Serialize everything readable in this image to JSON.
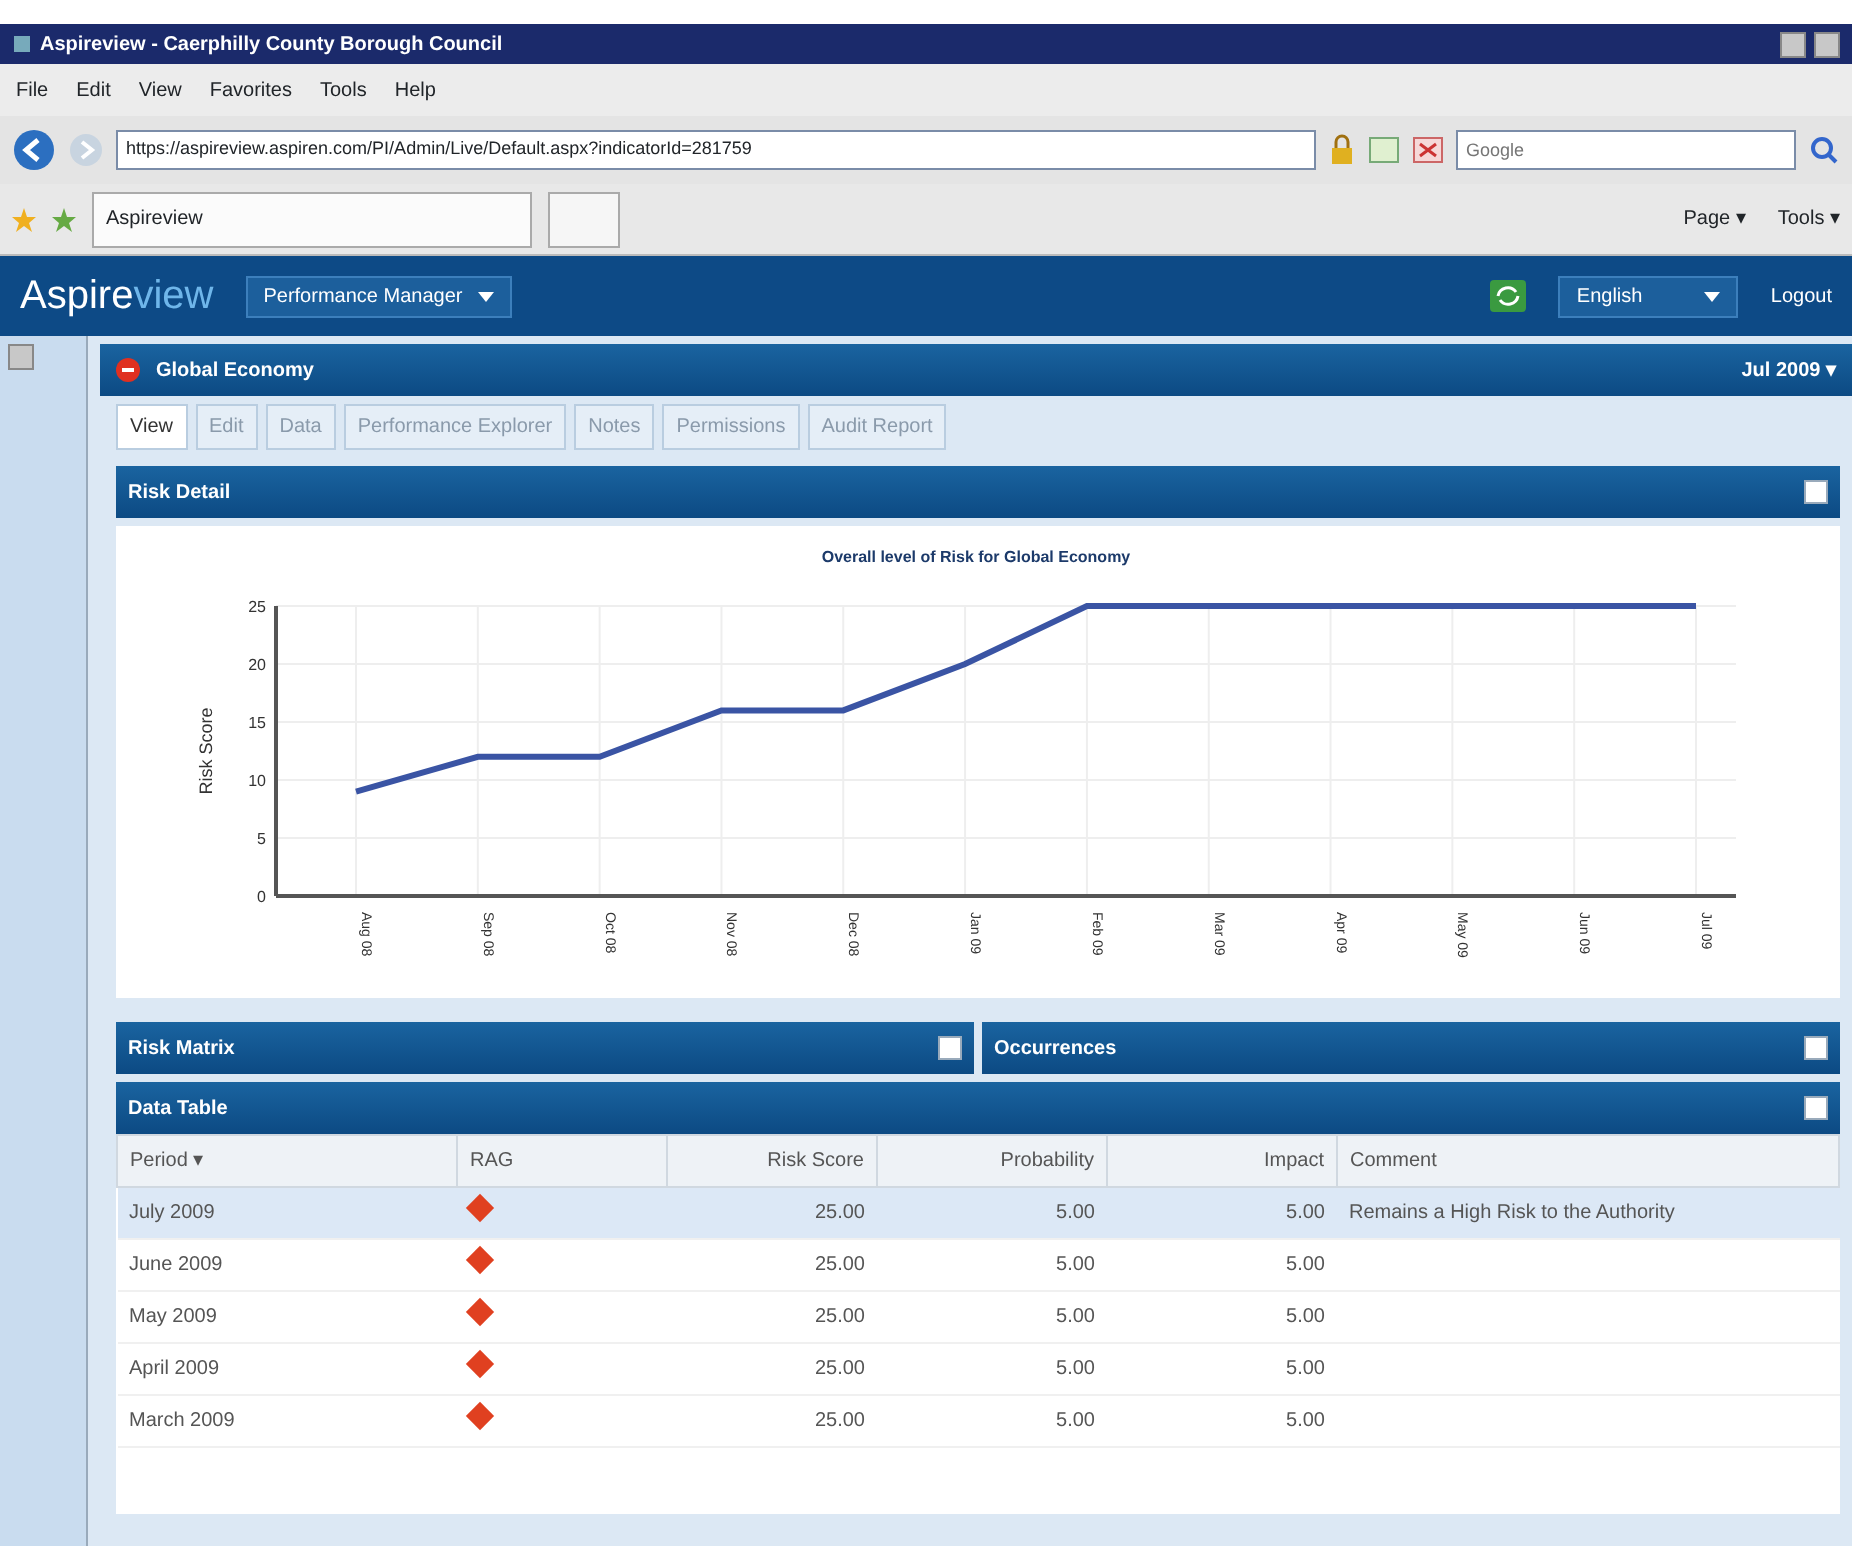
{
  "window": {
    "title": "Aspireview - Caerphilly County Borough Council"
  },
  "menu": [
    "File",
    "Edit",
    "View",
    "Favorites",
    "Tools",
    "Help"
  ],
  "address_bar": {
    "url": "https://aspireview.aspiren.com/PI/Admin/Live/Default.aspx?indicatorId=281759",
    "search_placeholder": "Google"
  },
  "browser_tabs": [
    {
      "label": "Aspireview",
      "selected": true
    }
  ],
  "browser_tools": [
    "Page ▾",
    "Tools ▾"
  ],
  "app_header": {
    "logo_main": "Aspire",
    "logo_accent": "view",
    "module": "Performance Manager",
    "language": "English",
    "logout": "Logout"
  },
  "indicator": {
    "title": "Global Economy",
    "period": "Jul 2009 ▾"
  },
  "tabs": [
    {
      "label": "View",
      "selected": true
    },
    {
      "label": "Edit",
      "selected": false
    },
    {
      "label": "Data",
      "selected": false
    },
    {
      "label": "Performance Explorer",
      "selected": false
    },
    {
      "label": "Notes",
      "selected": false
    },
    {
      "label": "Permissions",
      "selected": false
    },
    {
      "label": "Audit Report",
      "selected": false
    }
  ],
  "risk_detail": {
    "title": "Risk Detail",
    "chart_data": {
      "type": "line",
      "title": "Overall level of Risk for Global Economy",
      "ylabel": "Risk Score",
      "categories": [
        "Aug 08",
        "Sep 08",
        "Oct 08",
        "Nov 08",
        "Dec 08",
        "Jan 09",
        "Feb 09",
        "Mar 09",
        "Apr 09",
        "May 09",
        "Jun 09",
        "Jul 09"
      ],
      "grid": true,
      "series": [
        {
          "color": "#3a54a4",
          "values": [
            9,
            12,
            12,
            16,
            16,
            20,
            25,
            25,
            25,
            25,
            25,
            25
          ]
        }
      ],
      "ylim": [
        0,
        25
      ],
      "yticks": [
        0,
        5,
        10,
        15,
        20,
        25
      ]
    }
  },
  "panels": [
    {
      "title": "Risk Matrix"
    },
    {
      "title": "Occurrences"
    }
  ],
  "data_table": {
    "title": "Data Table",
    "columns": [
      "Period ▾",
      "RAG",
      "Risk Score",
      "Probability",
      "Impact",
      "Comment"
    ],
    "rows": [
      {
        "period": "July 2009",
        "risk_score": "25.00",
        "probability": "5.00",
        "impact": "5.00",
        "comment": "Remains a High Risk to the Authority",
        "selected": true
      },
      {
        "period": "June 2009",
        "risk_score": "25.00",
        "probability": "5.00",
        "impact": "5.00",
        "selected": false
      },
      {
        "period": "May 2009",
        "risk_score": "25.00",
        "probability": "5.00",
        "impact": "5.00",
        "selected": false
      },
      {
        "period": "April 2009",
        "risk_score": "25.00",
        "probability": "5.00",
        "impact": "5.00",
        "selected": false
      },
      {
        "period": "March 2009",
        "risk_score": "25.00",
        "probability": "5.00",
        "impact": "5.00",
        "selected": false
      }
    ]
  }
}
